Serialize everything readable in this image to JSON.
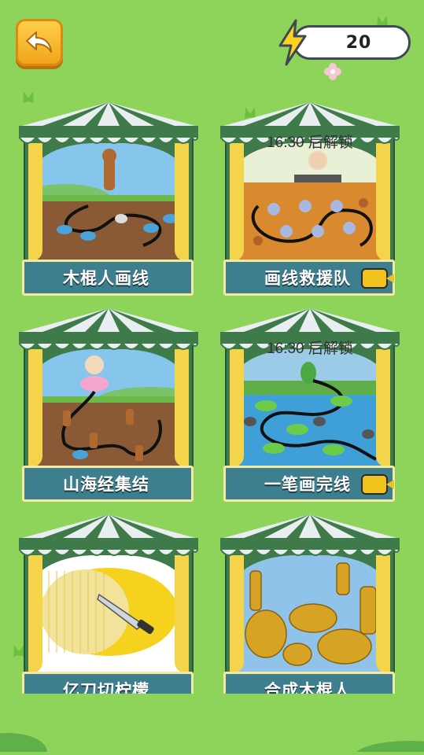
{
  "energy": {
    "value": "20"
  },
  "colors": {
    "background": "#8fd45a",
    "label_bg": "#3d7f8e",
    "label_border": "#f3e9a0",
    "button_orange": "#f0a51c"
  },
  "games": [
    {
      "title": "木棍人画线",
      "locked": false,
      "video": false
    },
    {
      "title": "画线救援队",
      "locked": true,
      "lock_text": "16:30 后解锁",
      "video": true
    },
    {
      "title": "山海经集结",
      "locked": false,
      "video": false
    },
    {
      "title": "一笔画完线",
      "locked": true,
      "lock_text": "16:30 后解锁",
      "video": true
    },
    {
      "title": "亿刀切柠檬",
      "locked": false,
      "video": false
    },
    {
      "title": "合成木棍人",
      "locked": false,
      "video": false
    }
  ]
}
